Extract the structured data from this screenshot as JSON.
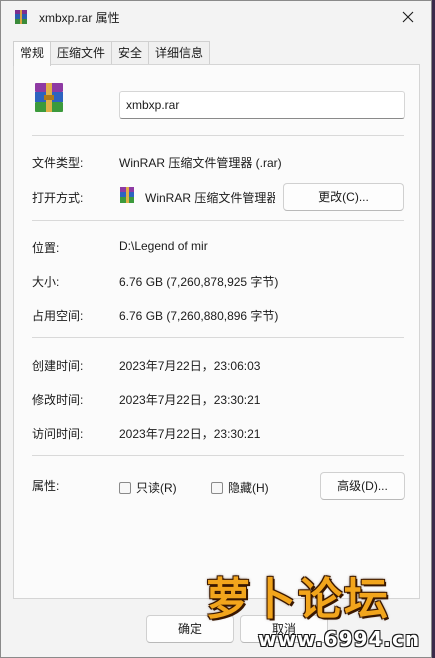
{
  "window": {
    "title": "xmbxp.rar 属性",
    "close_icon": "close-icon"
  },
  "tabs": [
    {
      "label": "常规",
      "active": true
    },
    {
      "label": "压缩文件",
      "active": false
    },
    {
      "label": "安全",
      "active": false
    },
    {
      "label": "详细信息",
      "active": false
    }
  ],
  "general": {
    "file_name": "xmbxp.rar",
    "file_type_label": "文件类型:",
    "file_type_value": "WinRAR 压缩文件管理器 (.rar)",
    "opens_with_label": "打开方式:",
    "opens_with_value": "WinRAR 压缩文件管理器",
    "change_button": "更改(C)...",
    "location_label": "位置:",
    "location_value": "D:\\Legend of mir",
    "size_label": "大小:",
    "size_value": "6.76 GB (7,260,878,925 字节)",
    "size_on_disk_label": "占用空间:",
    "size_on_disk_value": "6.76 GB (7,260,880,896 字节)",
    "created_label": "创建时间:",
    "created_value": "2023年7月22日，23:06:03",
    "modified_label": "修改时间:",
    "modified_value": "2023年7月22日，23:30:21",
    "accessed_label": "访问时间:",
    "accessed_value": "2023年7月22日，23:30:21",
    "attributes_label": "属性:",
    "readonly_label": "只读(R)",
    "readonly_checked": false,
    "hidden_label": "隐藏(H)",
    "hidden_checked": false,
    "advanced_button": "高级(D)..."
  },
  "footer": {
    "ok_button": "确定",
    "cancel_button": "取消"
  },
  "watermark": {
    "text": "萝卜论坛",
    "url": "www.6994.cn"
  },
  "colors": {
    "window_bg": "#f3f3f3",
    "panel_bg": "#fbfbfb",
    "watermark_orange": "#f2a51c"
  }
}
